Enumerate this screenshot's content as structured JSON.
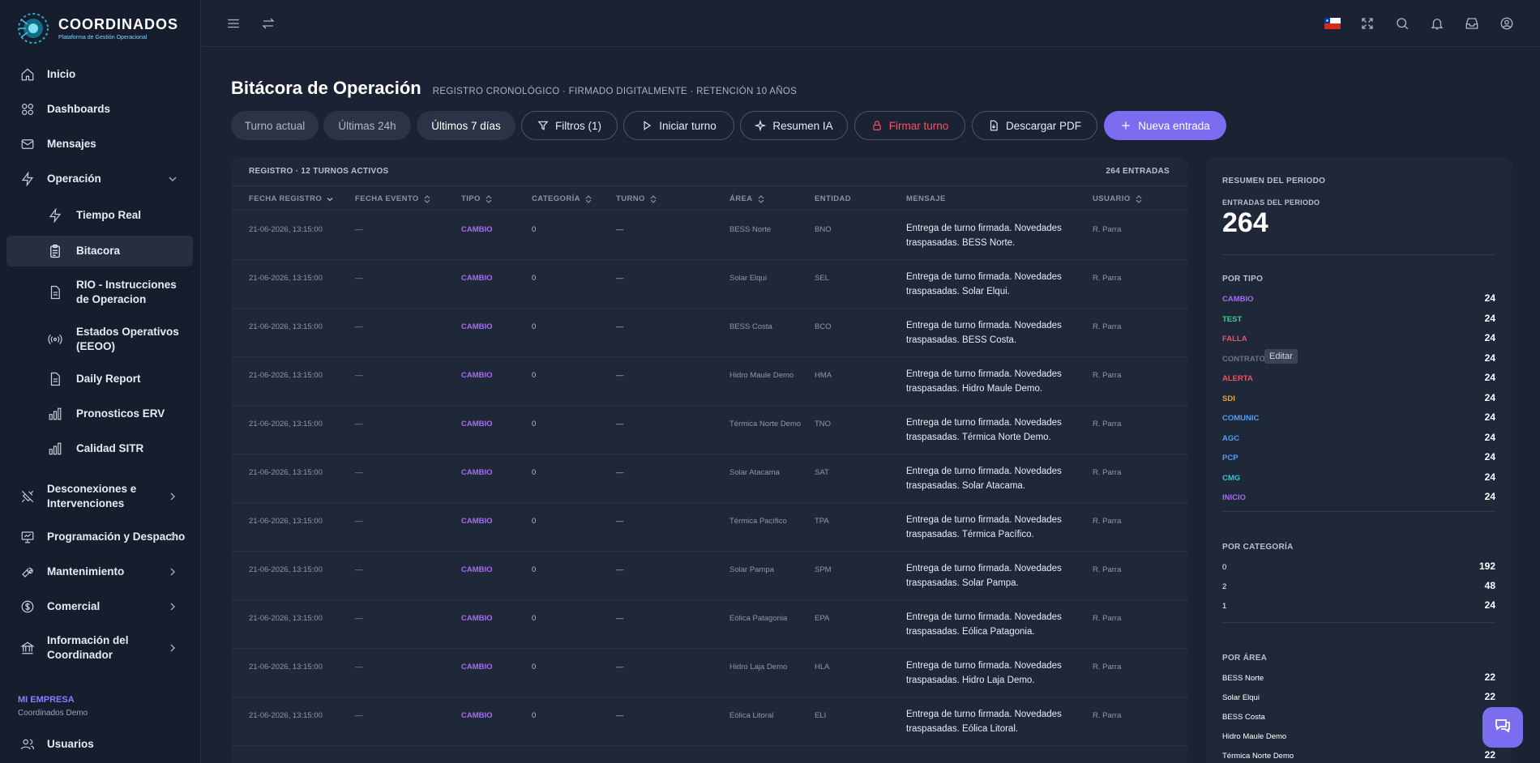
{
  "brand": {
    "title": "COORDINADOS",
    "subtitle": "Plataforma de Gestión Operacional"
  },
  "sidebar": {
    "items": [
      {
        "label": "Inicio"
      },
      {
        "label": "Dashboards"
      },
      {
        "label": "Mensajes"
      },
      {
        "label": "Operación"
      },
      {
        "label": "Tiempo Real"
      },
      {
        "label": "Bitacora"
      },
      {
        "label": "RIO - Instrucciones de Operacion"
      },
      {
        "label": "Estados Operativos (EEOO)"
      },
      {
        "label": "Daily Report"
      },
      {
        "label": "Pronosticos ERV"
      },
      {
        "label": "Calidad SITR"
      },
      {
        "label": "Desconexiones e Intervenciones"
      },
      {
        "label": "Programación y Despacho"
      },
      {
        "label": "Mantenimiento"
      },
      {
        "label": "Comercial"
      },
      {
        "label": "Información del Coordinador"
      },
      {
        "label": "Usuarios"
      }
    ],
    "company_label": "MI EMPRESA",
    "company_name": "Coordinados Demo"
  },
  "page": {
    "title": "Bitácora de Operación",
    "subtitle": "REGISTRO CRONOLÓGICO · FIRMADO DIGITALMENTE · RETENCIÓN 10 AÑOS"
  },
  "toolbar": {
    "seg1": "Turno actual",
    "seg2": "Últimas 24h",
    "seg3": "Últimos 7 días",
    "filters": "Filtros (1)",
    "start_shift": "Iniciar turno",
    "ai_summary": "Resumen IA",
    "sign_shift": "Firmar turno",
    "download_pdf": "Descargar PDF",
    "new_entry": "Nueva entrada"
  },
  "table": {
    "caption": "REGISTRO · 12 TURNOS ACTIVOS",
    "count": "264 ENTRADAS",
    "headers": [
      "FECHA REGISTRO",
      "FECHA EVENTO",
      "TIPO",
      "CATEGORÍA",
      "TURNO",
      "ÁREA",
      "ENTIDAD",
      "MENSAJE",
      "USUARIO"
    ],
    "rows": [
      {
        "fecha": "21-06-2026, 13:15:00",
        "evento": "—",
        "tipo": "CAMBIO",
        "cat": "0",
        "turno": "—",
        "area": "BESS Norte",
        "entidad": "BNO",
        "msg": "Entrega de turno firmada. Novedades traspasadas. BESS Norte.",
        "user": "R. Parra"
      },
      {
        "fecha": "21-06-2026, 13:15:00",
        "evento": "—",
        "tipo": "CAMBIO",
        "cat": "0",
        "turno": "—",
        "area": "Solar Elqui",
        "entidad": "SEL",
        "msg": "Entrega de turno firmada. Novedades traspasadas. Solar Elqui.",
        "user": "R. Parra"
      },
      {
        "fecha": "21-06-2026, 13:15:00",
        "evento": "—",
        "tipo": "CAMBIO",
        "cat": "0",
        "turno": "—",
        "area": "BESS Costa",
        "entidad": "BCO",
        "msg": "Entrega de turno firmada. Novedades traspasadas. BESS Costa.",
        "user": "R. Parra"
      },
      {
        "fecha": "21-06-2026, 13:15:00",
        "evento": "—",
        "tipo": "CAMBIO",
        "cat": "0",
        "turno": "—",
        "area": "Hidro Maule Demo",
        "entidad": "HMA",
        "msg": "Entrega de turno firmada. Novedades traspasadas. Hidro Maule Demo.",
        "user": "R. Parra"
      },
      {
        "fecha": "21-06-2026, 13:15:00",
        "evento": "—",
        "tipo": "CAMBIO",
        "cat": "0",
        "turno": "—",
        "area": "Térmica Norte Demo",
        "entidad": "TNO",
        "msg": "Entrega de turno firmada. Novedades traspasadas. Térmica Norte Demo.",
        "user": "R. Parra"
      },
      {
        "fecha": "21-06-2026, 13:15:00",
        "evento": "—",
        "tipo": "CAMBIO",
        "cat": "0",
        "turno": "—",
        "area": "Solar Atacama",
        "entidad": "SAT",
        "msg": "Entrega de turno firmada. Novedades traspasadas. Solar Atacama.",
        "user": "R. Parra"
      },
      {
        "fecha": "21-06-2026, 13:15:00",
        "evento": "—",
        "tipo": "CAMBIO",
        "cat": "0",
        "turno": "—",
        "area": "Térmica Pacífico",
        "entidad": "TPA",
        "msg": "Entrega de turno firmada. Novedades traspasadas. Térmica Pacífico.",
        "user": "R. Parra"
      },
      {
        "fecha": "21-06-2026, 13:15:00",
        "evento": "—",
        "tipo": "CAMBIO",
        "cat": "0",
        "turno": "—",
        "area": "Solar Pampa",
        "entidad": "SPM",
        "msg": "Entrega de turno firmada. Novedades traspasadas. Solar Pampa.",
        "user": "R. Parra"
      },
      {
        "fecha": "21-06-2026, 13:15:00",
        "evento": "—",
        "tipo": "CAMBIO",
        "cat": "0",
        "turno": "—",
        "area": "Eólica Patagonia",
        "entidad": "EPA",
        "msg": "Entrega de turno firmada. Novedades traspasadas. Eólica Patagonia.",
        "user": "R. Parra"
      },
      {
        "fecha": "21-06-2026, 13:15:00",
        "evento": "—",
        "tipo": "CAMBIO",
        "cat": "0",
        "turno": "—",
        "area": "Hidro Laja Demo",
        "entidad": "HLA",
        "msg": "Entrega de turno firmada. Novedades traspasadas. Hidro Laja Demo.",
        "user": "R. Parra"
      },
      {
        "fecha": "21-06-2026, 13:15:00",
        "evento": "—",
        "tipo": "CAMBIO",
        "cat": "0",
        "turno": "—",
        "area": "Eólica Litoral",
        "entidad": "ELI",
        "msg": "Entrega de turno firmada. Novedades traspasadas. Eólica Litoral.",
        "user": "R. Parra"
      }
    ]
  },
  "summary": {
    "title": "RESUMEN DEL PERIODO",
    "entries_label": "ENTRADAS DEL PERIODO",
    "entries_value": "264",
    "by_type_label": "POR TIPO",
    "by_type": [
      {
        "k": "CAMBIO",
        "v": "24",
        "color": "#a66cf0"
      },
      {
        "k": "TEST",
        "v": "24",
        "color": "#3ecf8e"
      },
      {
        "k": "FALLA",
        "v": "24",
        "color": "#f0525f"
      },
      {
        "k": "CONTRATO",
        "v": "24",
        "color": "#6b7587"
      },
      {
        "k": "ALERTA",
        "v": "24",
        "color": "#f0525f"
      },
      {
        "k": "SDI",
        "v": "24",
        "color": "#f0a324"
      },
      {
        "k": "COMUNIC",
        "v": "24",
        "color": "#4ea0f5"
      },
      {
        "k": "AGC",
        "v": "24",
        "color": "#4ea0f5"
      },
      {
        "k": "PCP",
        "v": "24",
        "color": "#4ea0f5"
      },
      {
        "k": "CMG",
        "v": "24",
        "color": "#2fc6d8"
      },
      {
        "k": "INICIO",
        "v": "24",
        "color": "#a66cf0"
      }
    ],
    "by_cat_label": "POR CATEGORÍA",
    "by_cat": [
      {
        "k": "0",
        "v": "192"
      },
      {
        "k": "2",
        "v": "48"
      },
      {
        "k": "1",
        "v": "24"
      }
    ],
    "by_area_label": "POR ÁREA",
    "by_area": [
      {
        "k": "BESS Norte",
        "v": "22"
      },
      {
        "k": "Solar Elqui",
        "v": "22"
      },
      {
        "k": "BESS Costa",
        "v": ""
      },
      {
        "k": "Hidro Maule Demo",
        "v": ""
      },
      {
        "k": "Térmica Norte Demo",
        "v": "22"
      }
    ]
  },
  "tooltip": "Editar"
}
